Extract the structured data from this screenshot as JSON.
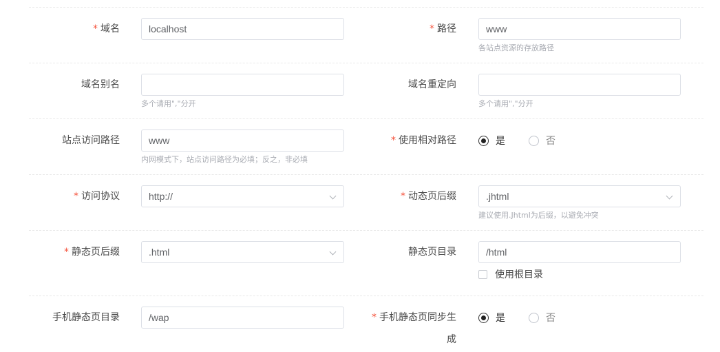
{
  "rows": [
    {
      "left": {
        "label": "域名",
        "required": true,
        "value": "localhost",
        "hint": ""
      },
      "right": {
        "label": "路径",
        "required": true,
        "value": "www",
        "hint": "各站点资源的存放路径"
      }
    },
    {
      "left": {
        "label": "域名别名",
        "required": false,
        "value": "",
        "hint": "多个请用\",\"分开"
      },
      "right": {
        "label": "域名重定向",
        "required": false,
        "value": "",
        "hint": "多个请用\",\"分开"
      }
    },
    {
      "left": {
        "label": "站点访问路径",
        "required": false,
        "value": "www",
        "hint": "内网模式下，站点访问路径为必填；反之，非必填"
      },
      "right": {
        "label": "使用相对路径",
        "required": true,
        "options": [
          "是",
          "否"
        ],
        "selected": "是"
      }
    },
    {
      "left": {
        "label": "访问协议",
        "required": true,
        "value": "http://",
        "hint": ""
      },
      "right": {
        "label": "动态页后缀",
        "required": true,
        "value": ".jhtml",
        "hint": "建议使用.Jhtml为后缀，以避免冲突"
      }
    },
    {
      "left": {
        "label": "静态页后缀",
        "required": true,
        "value": ".html",
        "hint": ""
      },
      "right": {
        "label": "静态页目录",
        "required": false,
        "value": "/html",
        "checkbox_label": "使用根目录",
        "checkbox_checked": false
      }
    },
    {
      "left": {
        "label": "手机静态页目录",
        "required": false,
        "value": "/wap",
        "hint": ""
      },
      "right": {
        "label_line1": "手机静态页同步生",
        "label_line2": "成",
        "required": true,
        "options": [
          "是",
          "否"
        ],
        "selected": "是"
      }
    }
  ],
  "required_mark": "*",
  "colors": {
    "required": "#f5533d",
    "border": "#dcdfe6",
    "hint": "#a8abb2"
  }
}
